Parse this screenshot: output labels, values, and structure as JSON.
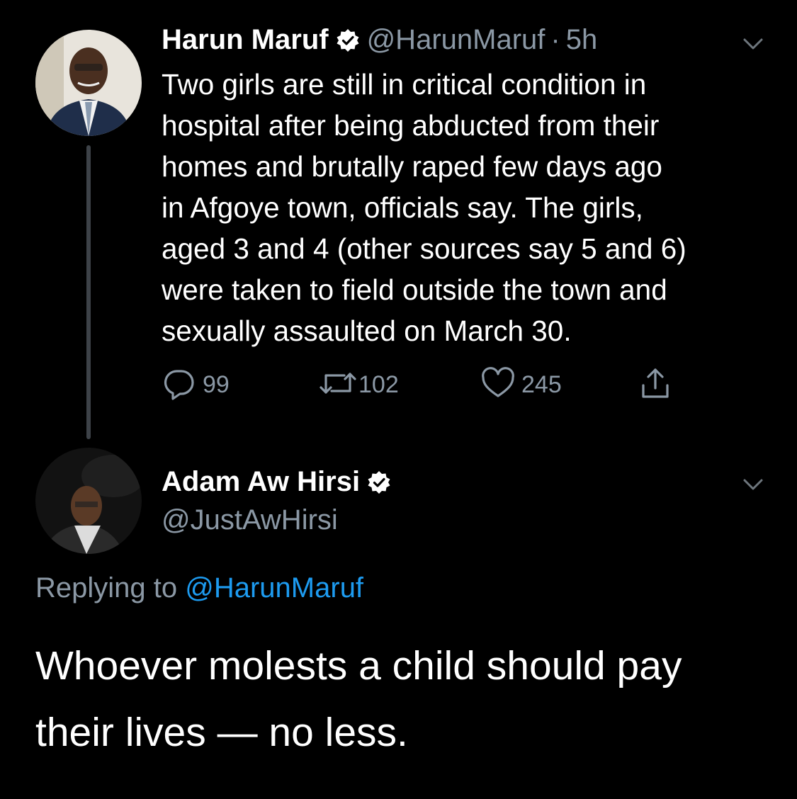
{
  "tweet": {
    "author": {
      "display_name": "Harun Maruf",
      "handle": "@HarunMaruf",
      "separator": "·",
      "time": "5h",
      "verified": true
    },
    "text": "Two girls are still in critical condition in\nhospital after being abducted from their\nhomes and brutally raped few days ago\nin Afgoye town, officials say. The girls,\naged 3 and 4 (other sources say 5 and 6)\nwere taken to field outside the town and\nsexually assaulted on March 30.",
    "actions": {
      "reply_count": "99",
      "retweet_count": "102",
      "like_count": "245"
    }
  },
  "reply": {
    "author": {
      "display_name": "Adam Aw Hirsi",
      "handle": "@JustAwHirsi",
      "verified": true
    },
    "replying_to_prefix": "Replying to",
    "replying_to_handle": "@HarunMaruf",
    "text": "Whoever molests a child should pay\ntheir lives — no less."
  },
  "colors": {
    "background": "#000000",
    "secondary_text": "#8b98a5",
    "link": "#1d9bf0",
    "thread_line": "#3d4248"
  },
  "icons": [
    "verified-badge-icon",
    "chevron-down-icon",
    "reply-icon",
    "retweet-icon",
    "like-icon",
    "share-icon"
  ]
}
